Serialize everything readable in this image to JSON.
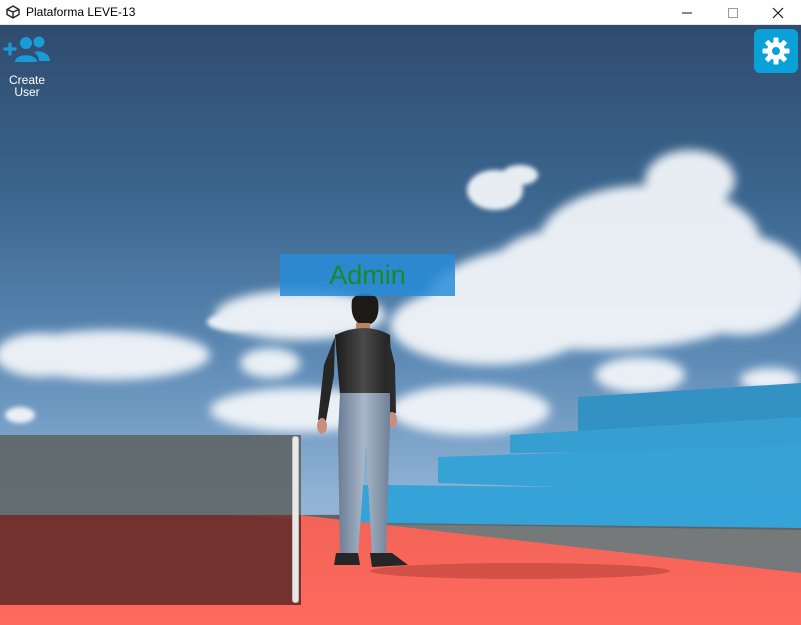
{
  "window": {
    "title": "Plataforma LEVE-13",
    "app_icon": "unity-icon",
    "controls": [
      "minimize-icon",
      "maximize-icon",
      "close-icon"
    ]
  },
  "toolbar": {
    "create_user_icon": "add-user-icon",
    "create_user_label": "Create\nUser",
    "settings_icon": "gear-icon"
  },
  "scene": {
    "player_name": "Admin"
  },
  "colors": {
    "accent": "#0aa1d9",
    "name_tag_bg": "#288cd7",
    "name_text": "#19892a",
    "floor": "#ff6a5e",
    "steps": "#33a2d4"
  }
}
